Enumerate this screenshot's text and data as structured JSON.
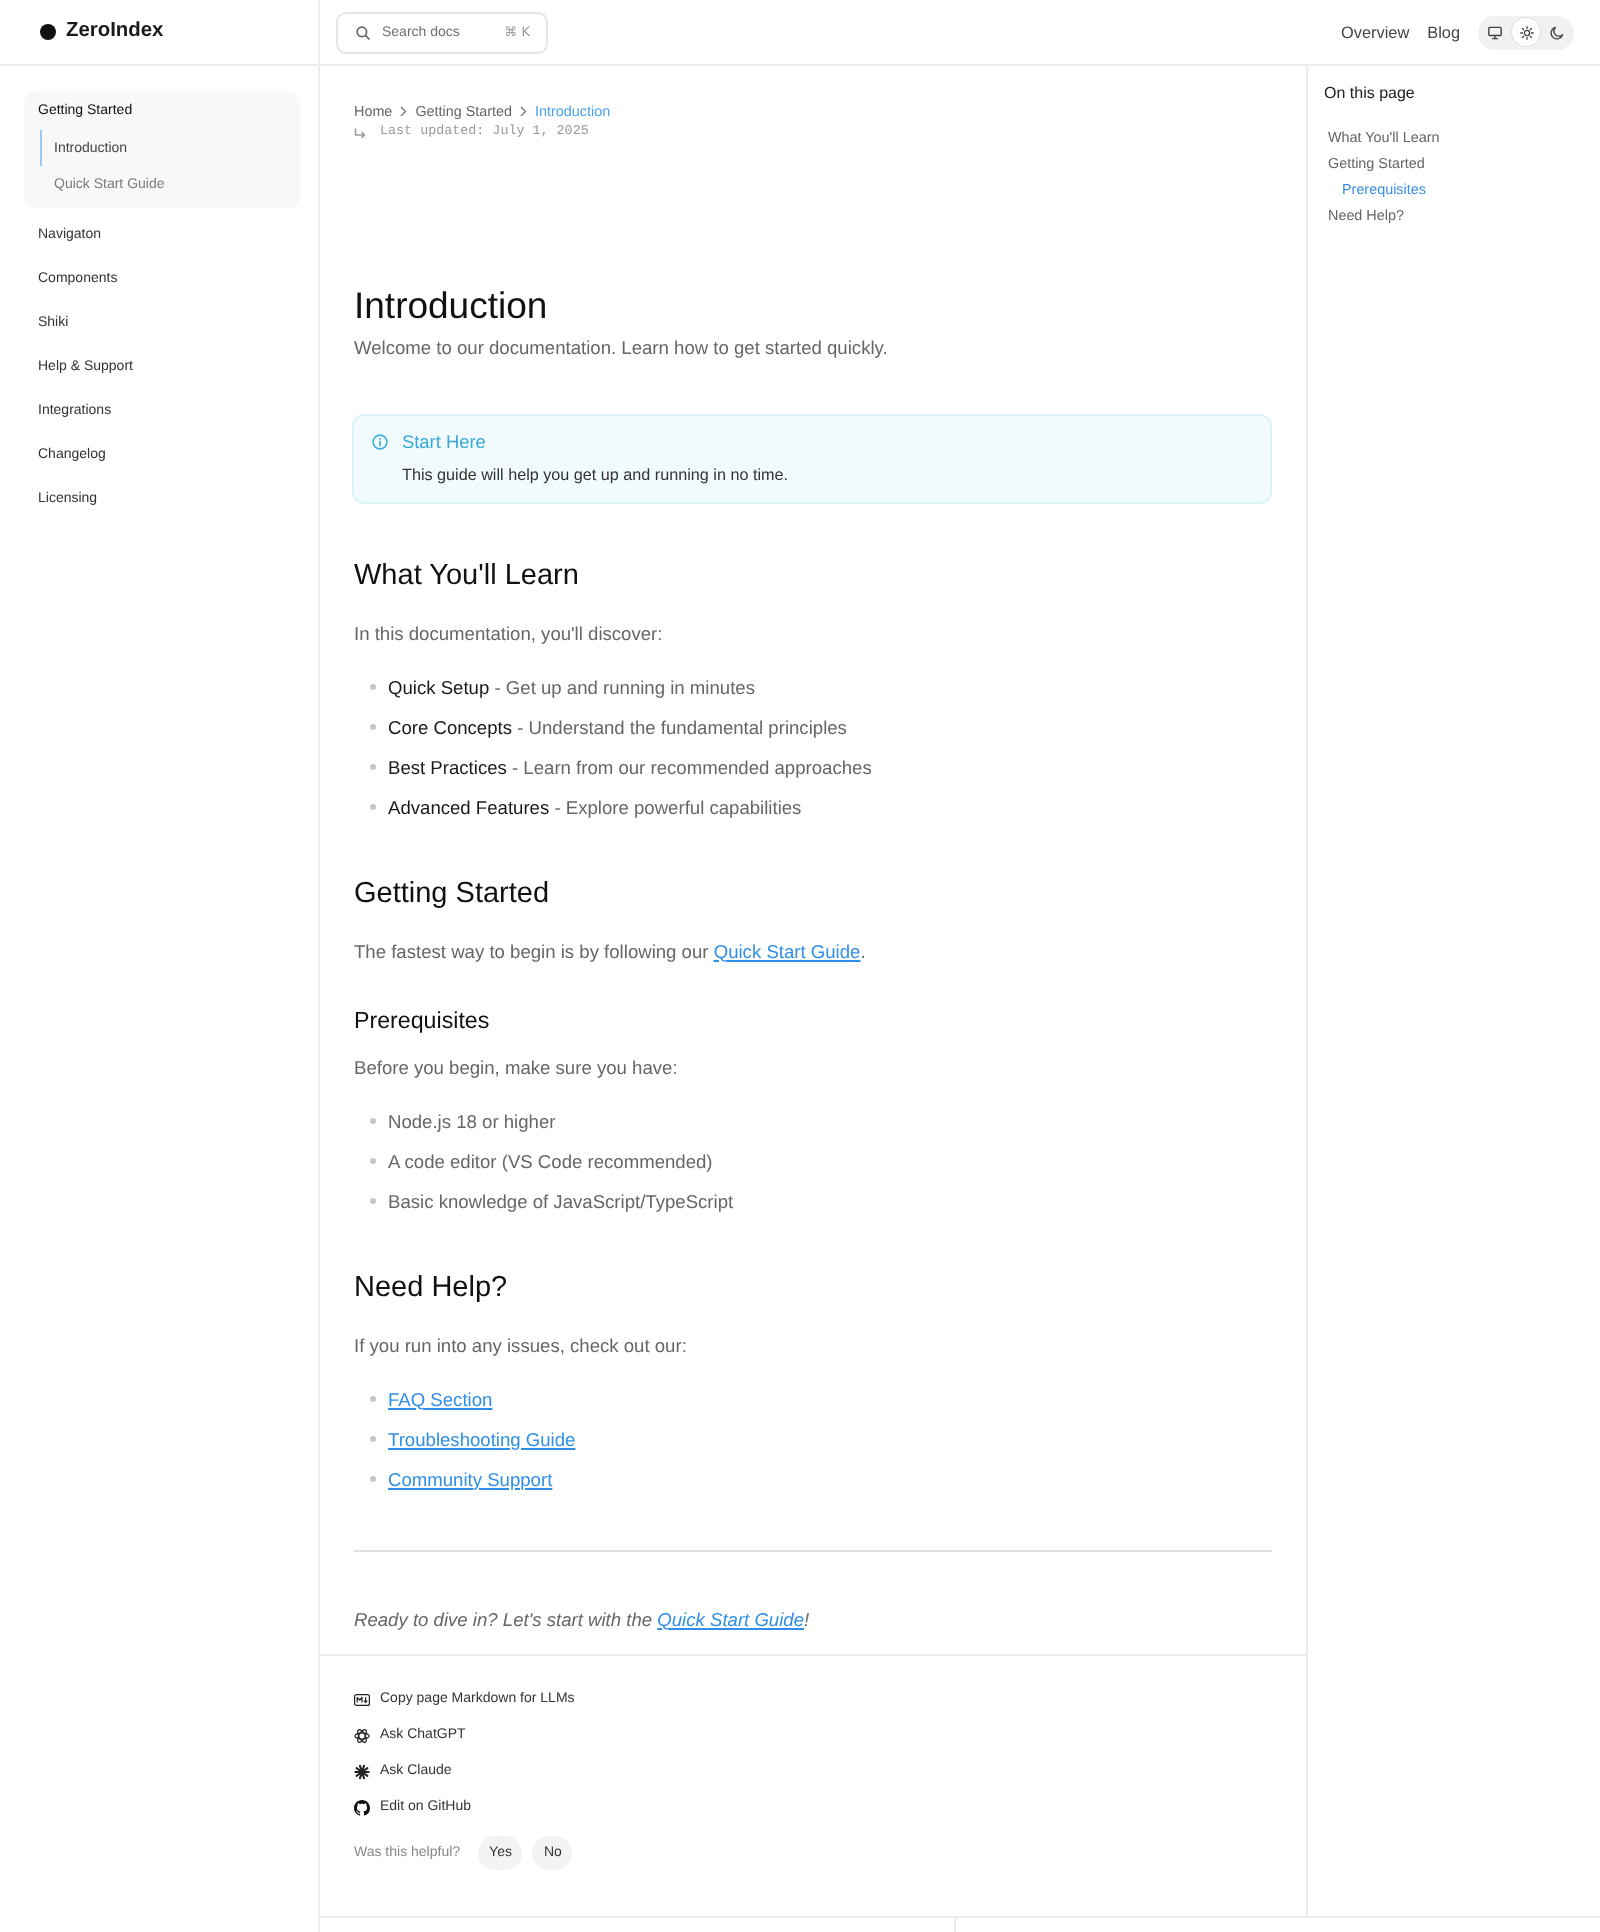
{
  "header": {
    "logo": "ZeroIndex",
    "search": {
      "placeholder": "Search docs",
      "shortcut": "⌘ K"
    },
    "nav": [
      "Overview",
      "Blog"
    ],
    "theme_options": [
      {
        "kind": "system",
        "selected": false
      },
      {
        "kind": "light",
        "selected": true
      },
      {
        "kind": "dark",
        "selected": false
      }
    ]
  },
  "sidebar": {
    "items": [
      {
        "label": "Getting Started",
        "expanded": true,
        "children": [
          {
            "label": "Introduction",
            "selected": true
          },
          {
            "label": "Quick Start Guide",
            "selected": false
          }
        ]
      },
      {
        "label": "Navigaton",
        "expanded": false
      },
      {
        "label": "Components",
        "expanded": false
      },
      {
        "label": "Shiki",
        "expanded": false
      },
      {
        "label": "Help & Support",
        "expanded": false
      },
      {
        "label": "Integrations",
        "expanded": false
      },
      {
        "label": "Changelog",
        "expanded": false
      },
      {
        "label": "Licensing",
        "expanded": false
      }
    ]
  },
  "breadcrumb": [
    {
      "label": "Home",
      "current": false
    },
    {
      "label": "Getting Started",
      "current": false
    },
    {
      "label": "Introduction",
      "current": true
    }
  ],
  "last_updated": "Last updated: July 1, 2025",
  "article": {
    "title": "Introduction",
    "lead": "Welcome to our documentation. Learn how to get started quickly.",
    "callout": {
      "title": "Start Here",
      "body": "This guide will help you get up and running in no time."
    },
    "blocks": [
      {
        "kind": "h2",
        "text": "What You'll Learn"
      },
      {
        "kind": "p",
        "text": "In this documentation, you'll discover:"
      },
      {
        "kind": "list",
        "items": [
          "**Quick Setup** - Get up and running in minutes",
          "**Core Concepts** - Understand the fundamental principles",
          "**Best Practices** - Learn from our recommended approaches",
          "**Advanced Features** - Explore powerful capabilities"
        ]
      },
      {
        "kind": "h2",
        "text": "Getting Started"
      },
      {
        "kind": "p",
        "text": "The fastest way to begin is by following our ",
        "link": "Quick Start Guide",
        "after": "."
      },
      {
        "kind": "h3",
        "text": "Prerequisites"
      },
      {
        "kind": "p",
        "text": "Before you begin, make sure you have:"
      },
      {
        "kind": "list",
        "items": [
          "Node.js 18 or higher",
          "A code editor (VS Code recommended)",
          "Basic knowledge of JavaScript/TypeScript"
        ]
      },
      {
        "kind": "h2",
        "text": "Need Help?"
      },
      {
        "kind": "p",
        "text": "If you run into any issues, check out our:"
      },
      {
        "kind": "links",
        "items": [
          "FAQ Section",
          "Troubleshooting Guide",
          "Community Support"
        ]
      },
      {
        "kind": "rule"
      },
      {
        "kind": "closing",
        "text": "Ready to dive in? Let's start with the ",
        "link": "Quick Start Guide",
        "after": "!"
      }
    ]
  },
  "page_actions": [
    {
      "kind": "markdown",
      "label": "Copy page Markdown for LLMs"
    },
    {
      "kind": "chatgpt",
      "label": "Ask ChatGPT"
    },
    {
      "kind": "claude",
      "label": "Ask Claude"
    },
    {
      "kind": "github",
      "label": "Edit on GitHub"
    }
  ],
  "feedback": {
    "question": "Was this helpful?",
    "buttons": [
      "Yes",
      "No"
    ]
  },
  "toc": {
    "title": "On this page",
    "items": [
      {
        "label": "What You'll Learn",
        "selected": false
      },
      {
        "label": "Getting Started",
        "selected": false,
        "children": [
          {
            "label": "Prerequisites",
            "selected": true
          }
        ]
      },
      {
        "label": "Need Help?",
        "selected": false
      }
    ]
  }
}
